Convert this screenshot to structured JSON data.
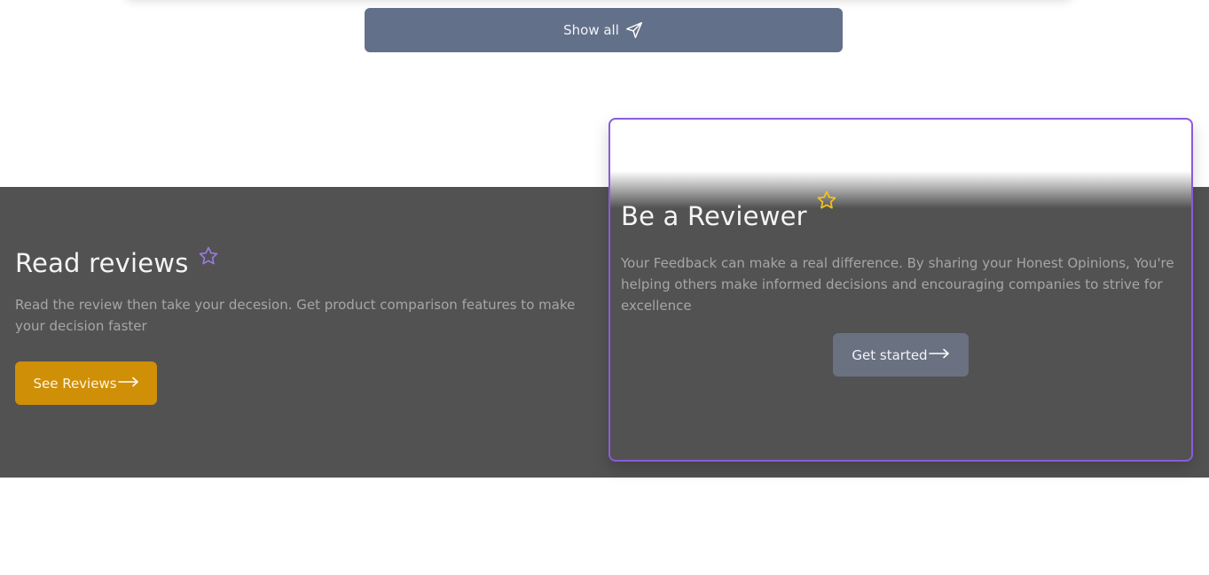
{
  "top": {
    "show_all_label": "Show all",
    "show_all_icon": "send-icon"
  },
  "read_reviews": {
    "title": "Read reviews",
    "description": "Read the review then take your decesion. Get product comparison features to make your decision faster",
    "button_label": "See Reviews",
    "star_color": "#9b7be8"
  },
  "be_reviewer": {
    "title": "Be a Reviewer",
    "description": "Your Feedback can make a real difference. By sharing your Honest Opinions, You're helping others make informed decisions and encouraging companies to strive for excellence",
    "button_label": "Get started",
    "star_color": "#f2c21b"
  },
  "colors": {
    "band": "#525252",
    "show_all_bg": "#637089",
    "see_reviews_bg": "#cf8f06",
    "get_started_bg": "#6a7181",
    "card_border": "#8a5cdb"
  }
}
